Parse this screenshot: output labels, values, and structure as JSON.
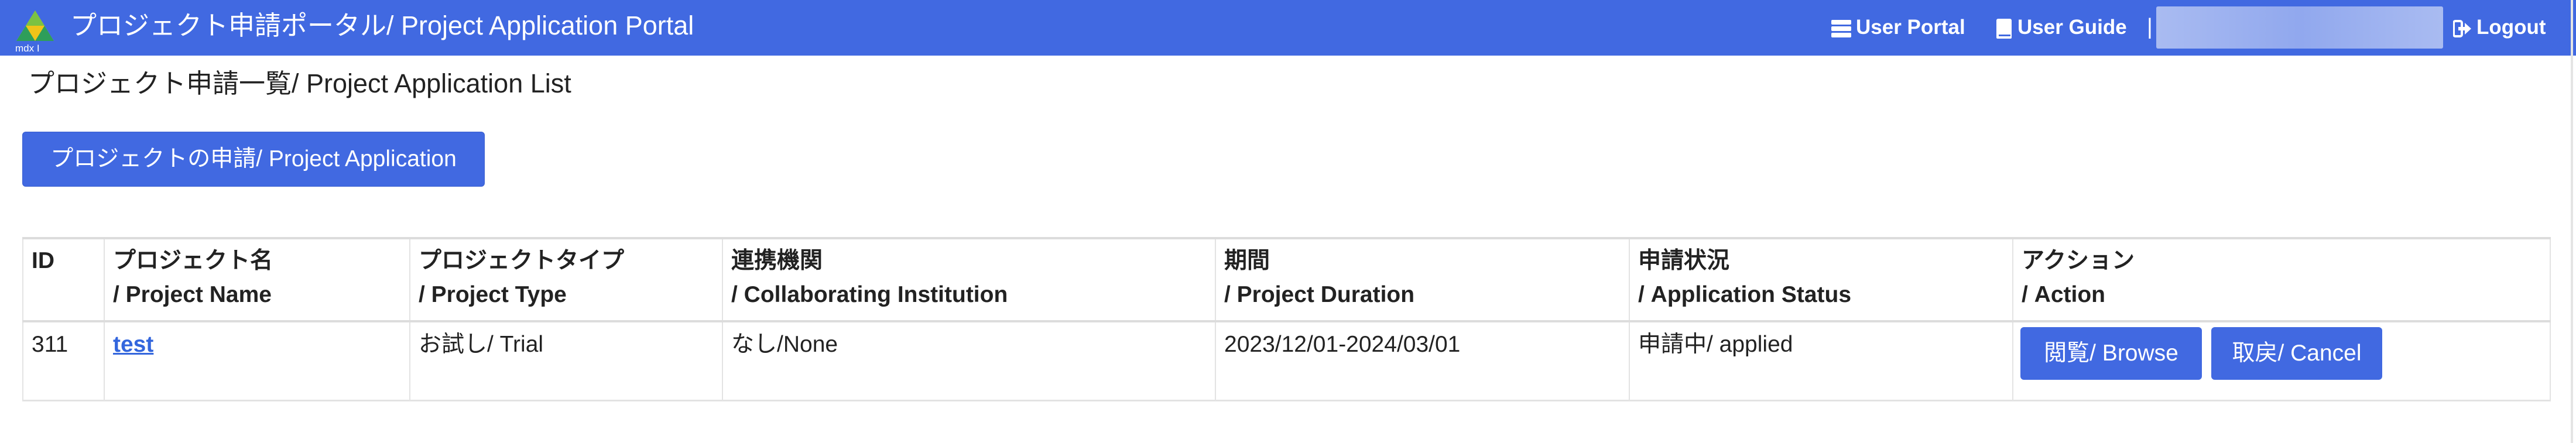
{
  "navbar": {
    "logo_text": "mdx I",
    "title": "プロジェクト申請ポータル/ Project Application Portal",
    "user_portal": "User Portal",
    "user_guide": "User Guide",
    "separator": "|",
    "logout": "Logout"
  },
  "page": {
    "heading": "プロジェクト申請一覧/ Project Application List",
    "apply_button": "プロジェクトの申請/ Project Application"
  },
  "table": {
    "headers": [
      {
        "line1": "ID",
        "line2": ""
      },
      {
        "line1": "プロジェクト名",
        "line2": "/ Project Name"
      },
      {
        "line1": "プロジェクトタイプ",
        "line2": "/ Project Type"
      },
      {
        "line1": "連携機関",
        "line2": "/ Collaborating Institution"
      },
      {
        "line1": "期間",
        "line2": "/ Project Duration"
      },
      {
        "line1": "申請状況",
        "line2": "/ Application Status"
      },
      {
        "line1": "アクション",
        "line2": "/ Action"
      }
    ],
    "rows": [
      {
        "id": "311",
        "name": "test",
        "type": "お試し/ Trial",
        "institution": "なし/None",
        "duration": "2023/12/01-2024/03/01",
        "status": "申請中/ applied",
        "browse": "閲覧/ Browse",
        "cancel": "取戻/ Cancel"
      }
    ]
  },
  "colors": {
    "primary": "#4169e1",
    "link": "#3366dd"
  }
}
